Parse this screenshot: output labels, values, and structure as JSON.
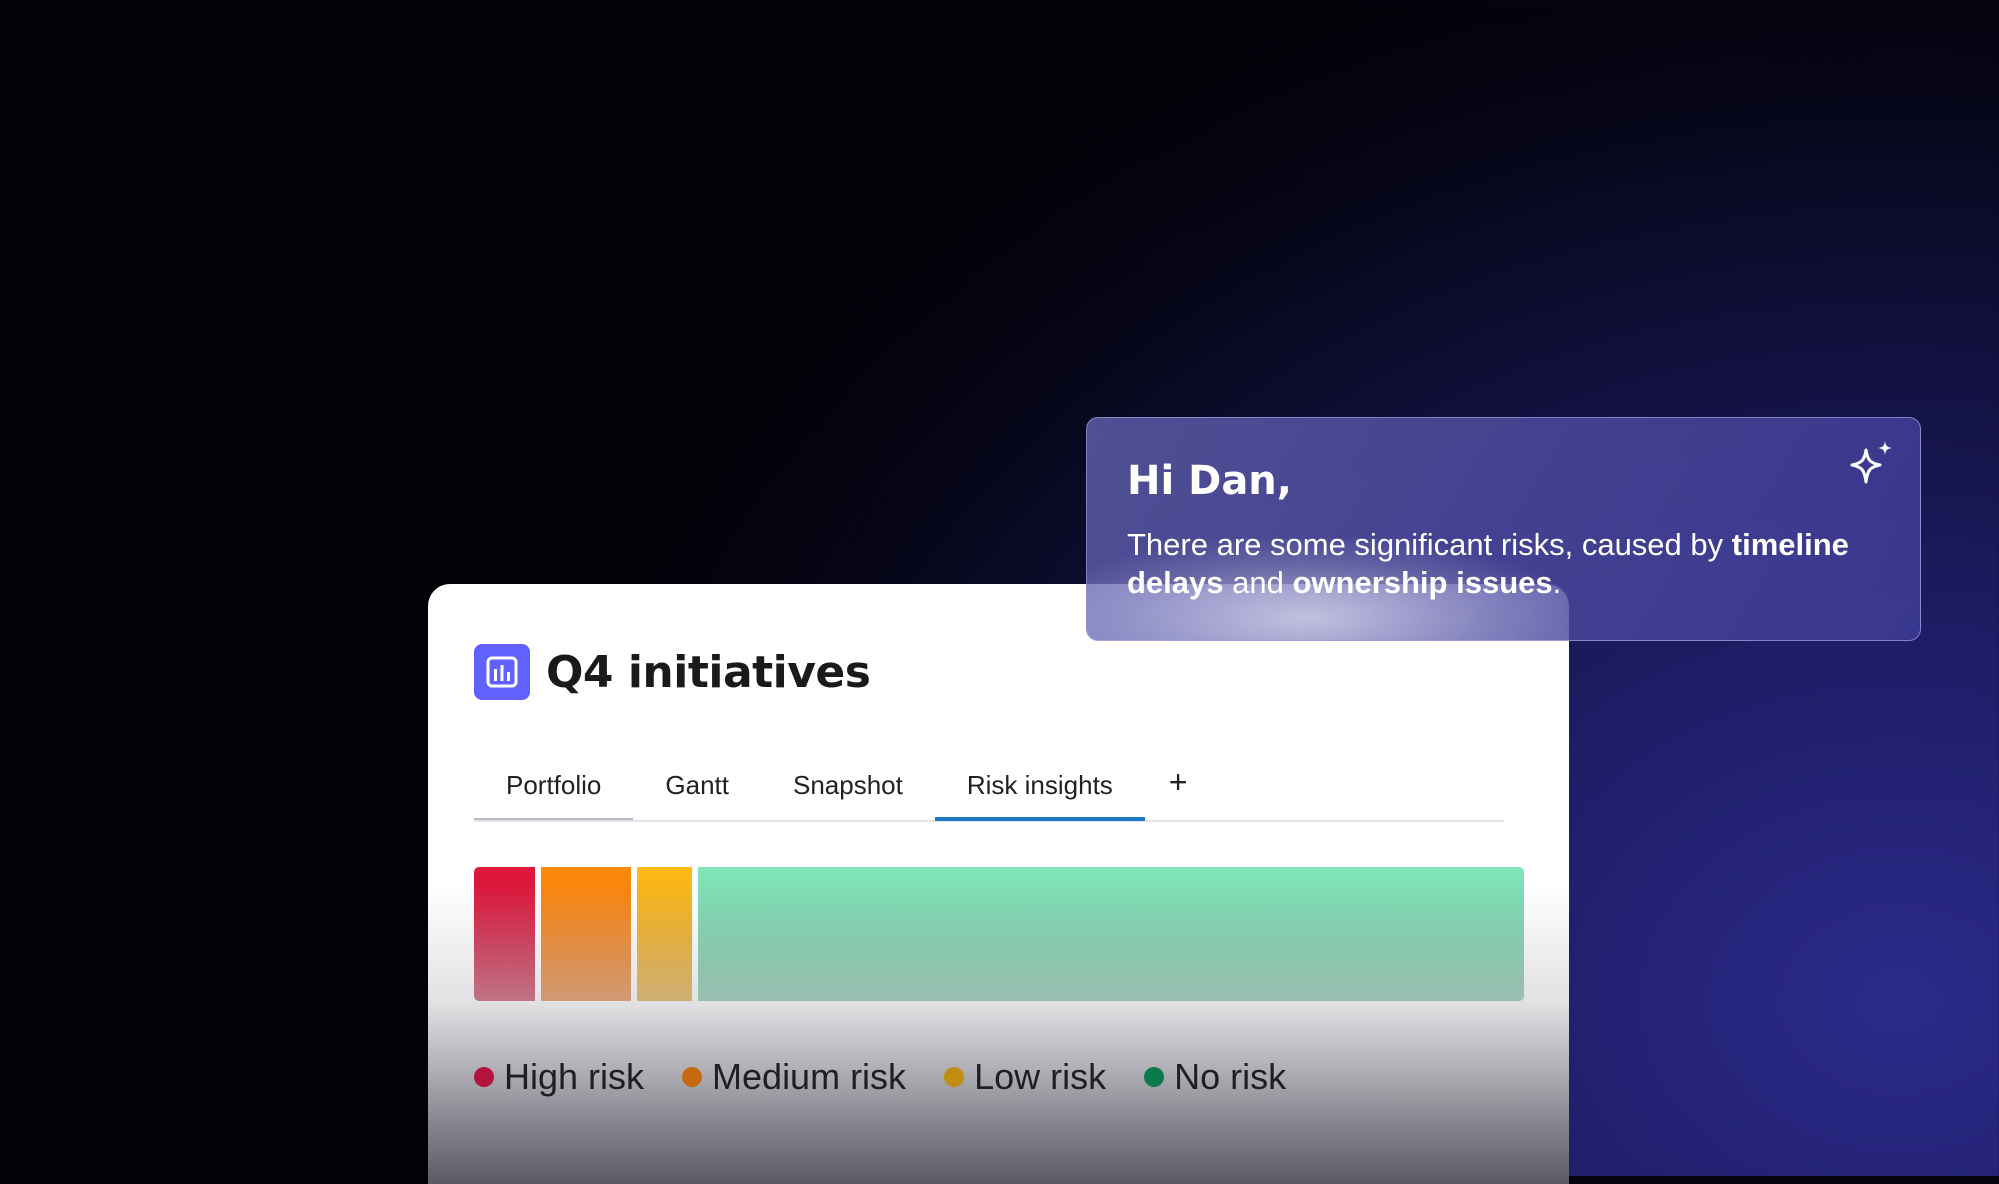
{
  "board": {
    "title": "Q4 initiatives",
    "icon": "board-chart-icon",
    "icon_color": "#6161ff",
    "tabs": [
      {
        "label": "Portfolio"
      },
      {
        "label": "Gantt"
      },
      {
        "label": "Snapshot"
      },
      {
        "label": "Risk insights",
        "active": true
      }
    ],
    "add_tab_label": "+",
    "risk_distribution": [
      {
        "label": "High risk",
        "share": 0.059,
        "color": "#e2173c",
        "dot_color": "#b3143b"
      },
      {
        "label": "Medium risk",
        "share": 0.087,
        "color": "#ff8a0a",
        "dot_color": "#c56a0e"
      },
      {
        "label": "Low risk",
        "share": 0.053,
        "color": "#ffbb1a",
        "dot_color": "#c18d12"
      },
      {
        "label": "No risk",
        "share": 0.801,
        "color": "#82e6bb",
        "dot_color": "#0c7a4a"
      }
    ]
  },
  "assistant": {
    "greeting": "Hi Dan,",
    "message_part1": "There are some significant risks, caused by ",
    "message_bold1": "timeline delays",
    "message_part2": " and ",
    "message_bold2": "ownership issues",
    "message_part3": ".",
    "icon": "sparkle-icon"
  }
}
